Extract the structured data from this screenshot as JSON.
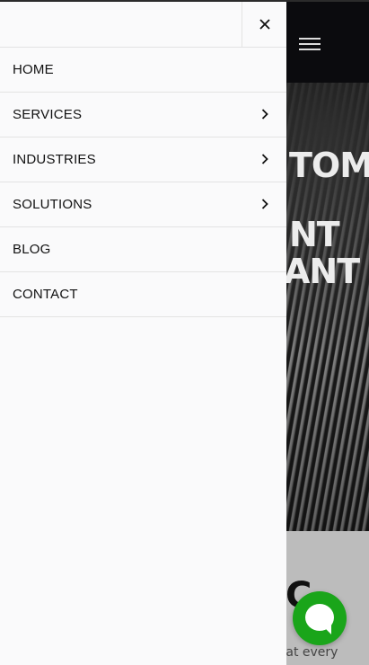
{
  "background": {
    "hero_lines": [
      "TOM",
      "NT",
      "ANT"
    ],
    "below_heading": "C",
    "below_text": "that every"
  },
  "drawer": {
    "close_icon": "close-icon",
    "items": [
      {
        "label": "HOME",
        "has_submenu": false
      },
      {
        "label": "SERVICES",
        "has_submenu": true
      },
      {
        "label": "INDUSTRIES",
        "has_submenu": true
      },
      {
        "label": "SOLUTIONS",
        "has_submenu": true
      },
      {
        "label": "BLOG",
        "has_submenu": false
      },
      {
        "label": "CONTACT",
        "has_submenu": false
      }
    ]
  },
  "colors": {
    "chat_button": "#1aa51a",
    "drawer_bg": "#fafafb",
    "header_bg": "#0b0b0e"
  },
  "icons": {
    "menu": "hamburger-icon",
    "chevron": "chevron-right-icon",
    "chat": "chat-icon"
  }
}
